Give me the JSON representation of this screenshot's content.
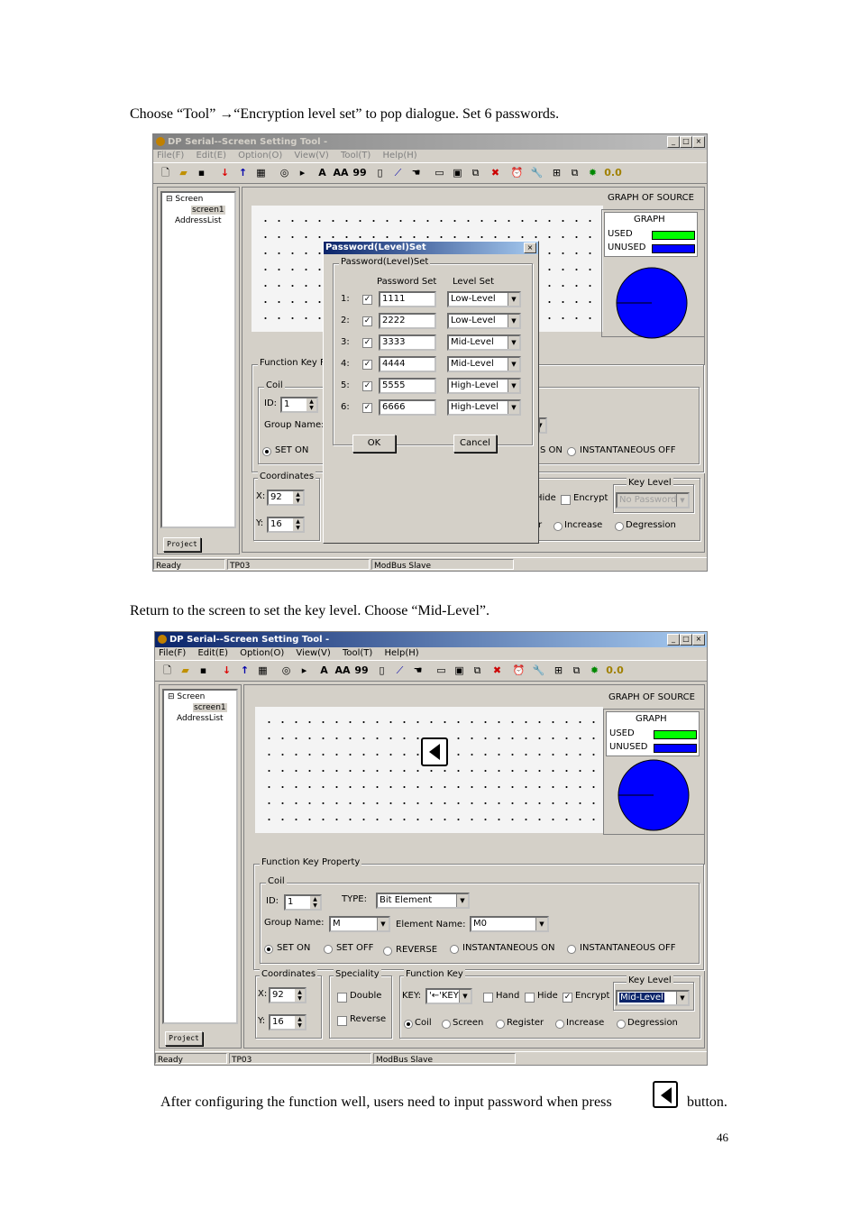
{
  "page": {
    "intro_text": "Choose “Tool” →“Encryption level set” to pop dialogue. Set 6 passwords.",
    "return_text": "Return to the screen to set the key level. Choose “Mid-Level”.",
    "after_text_1": "After configuring the function well, users need to input password when press",
    "after_text_2": "button.",
    "page_number": "46"
  },
  "app": {
    "title": "DP Serial--Screen Setting Tool -",
    "menu": [
      "File(F)",
      "Edit(E)",
      "Option(O)",
      "View(V)",
      "Tool(T)",
      "Help(H)"
    ],
    "toolbar_text": [
      "A",
      "AA",
      "99",
      "0.0"
    ],
    "tree": {
      "root": "Screen",
      "child": "screen1",
      "sibling": "AddressList"
    },
    "project_tab": "Project",
    "graph_of_source": "GRAPH OF SOURCE",
    "graph_title": "GRAPH",
    "used": "USED",
    "unused": "UNUSED",
    "status": {
      "left": "Ready",
      "mid": "TP03",
      "right": "ModBus Slave"
    },
    "colors": {
      "used": "#00ff00",
      "unused": "#0000ff",
      "pie": "#0000ff",
      "titlebar": "#0a246a"
    }
  },
  "dialog": {
    "title": "Password(Level)Set",
    "group_label": "Password(Level)Set",
    "col_password": "Password Set",
    "col_level": "Level Set",
    "rows": [
      {
        "num": "1:",
        "checked": "☑",
        "password": "1111",
        "level": "Low-Level"
      },
      {
        "num": "2:",
        "checked": "☑",
        "password": "2222",
        "level": "Low-Level"
      },
      {
        "num": "3:",
        "checked": "☑",
        "password": "3333",
        "level": "Mid-Level"
      },
      {
        "num": "4:",
        "checked": "☑",
        "password": "4444",
        "level": "Mid-Level"
      },
      {
        "num": "5:",
        "checked": "☑",
        "password": "5555",
        "level": "High-Level"
      },
      {
        "num": "6:",
        "checked": "☑",
        "password": "6666",
        "level": "High-Level"
      }
    ],
    "ok": "OK",
    "cancel": "Cancel"
  },
  "props": {
    "function_key_property": "Function Key Property",
    "function_key_partial": "Function Key F",
    "coil": "Coil",
    "id_label": "ID:",
    "id_value": "1",
    "type_label": "TYPE:",
    "type_value": "Bit Element",
    "group_name_label": "Group Name:",
    "group_name_value": "M",
    "element_name_label": "Element Name:",
    "element_name_value": "M0",
    "set_on": "SET ON",
    "set_off": "SET OFF",
    "reverse_opt": "REVERSE",
    "inst_on": "INSTANTANEOUS ON",
    "inst_off": "INSTANTANEOUS OFF",
    "s_on_partial": "S ON",
    "coordinates": "Coordinates",
    "x_label": "X:",
    "x_value": "92",
    "y_label": "Y:",
    "y_value": "16",
    "speciality": "Speciality",
    "double": "Double",
    "reverse": "Reverse",
    "function_key": "Function Key",
    "key_label": "KEY:",
    "key_value": "'←'KEY",
    "hand": "Hand",
    "hide": "Hide",
    "encrypt": "Encrypt",
    "key_level": "Key Level",
    "key_level_value_1": "No Password",
    "key_level_value_2": "Mid-Level",
    "radio_coil": "Coil",
    "radio_screen": "Screen",
    "radio_register": "Register",
    "radio_increase": "Increase",
    "radio_degression": "Degression"
  }
}
